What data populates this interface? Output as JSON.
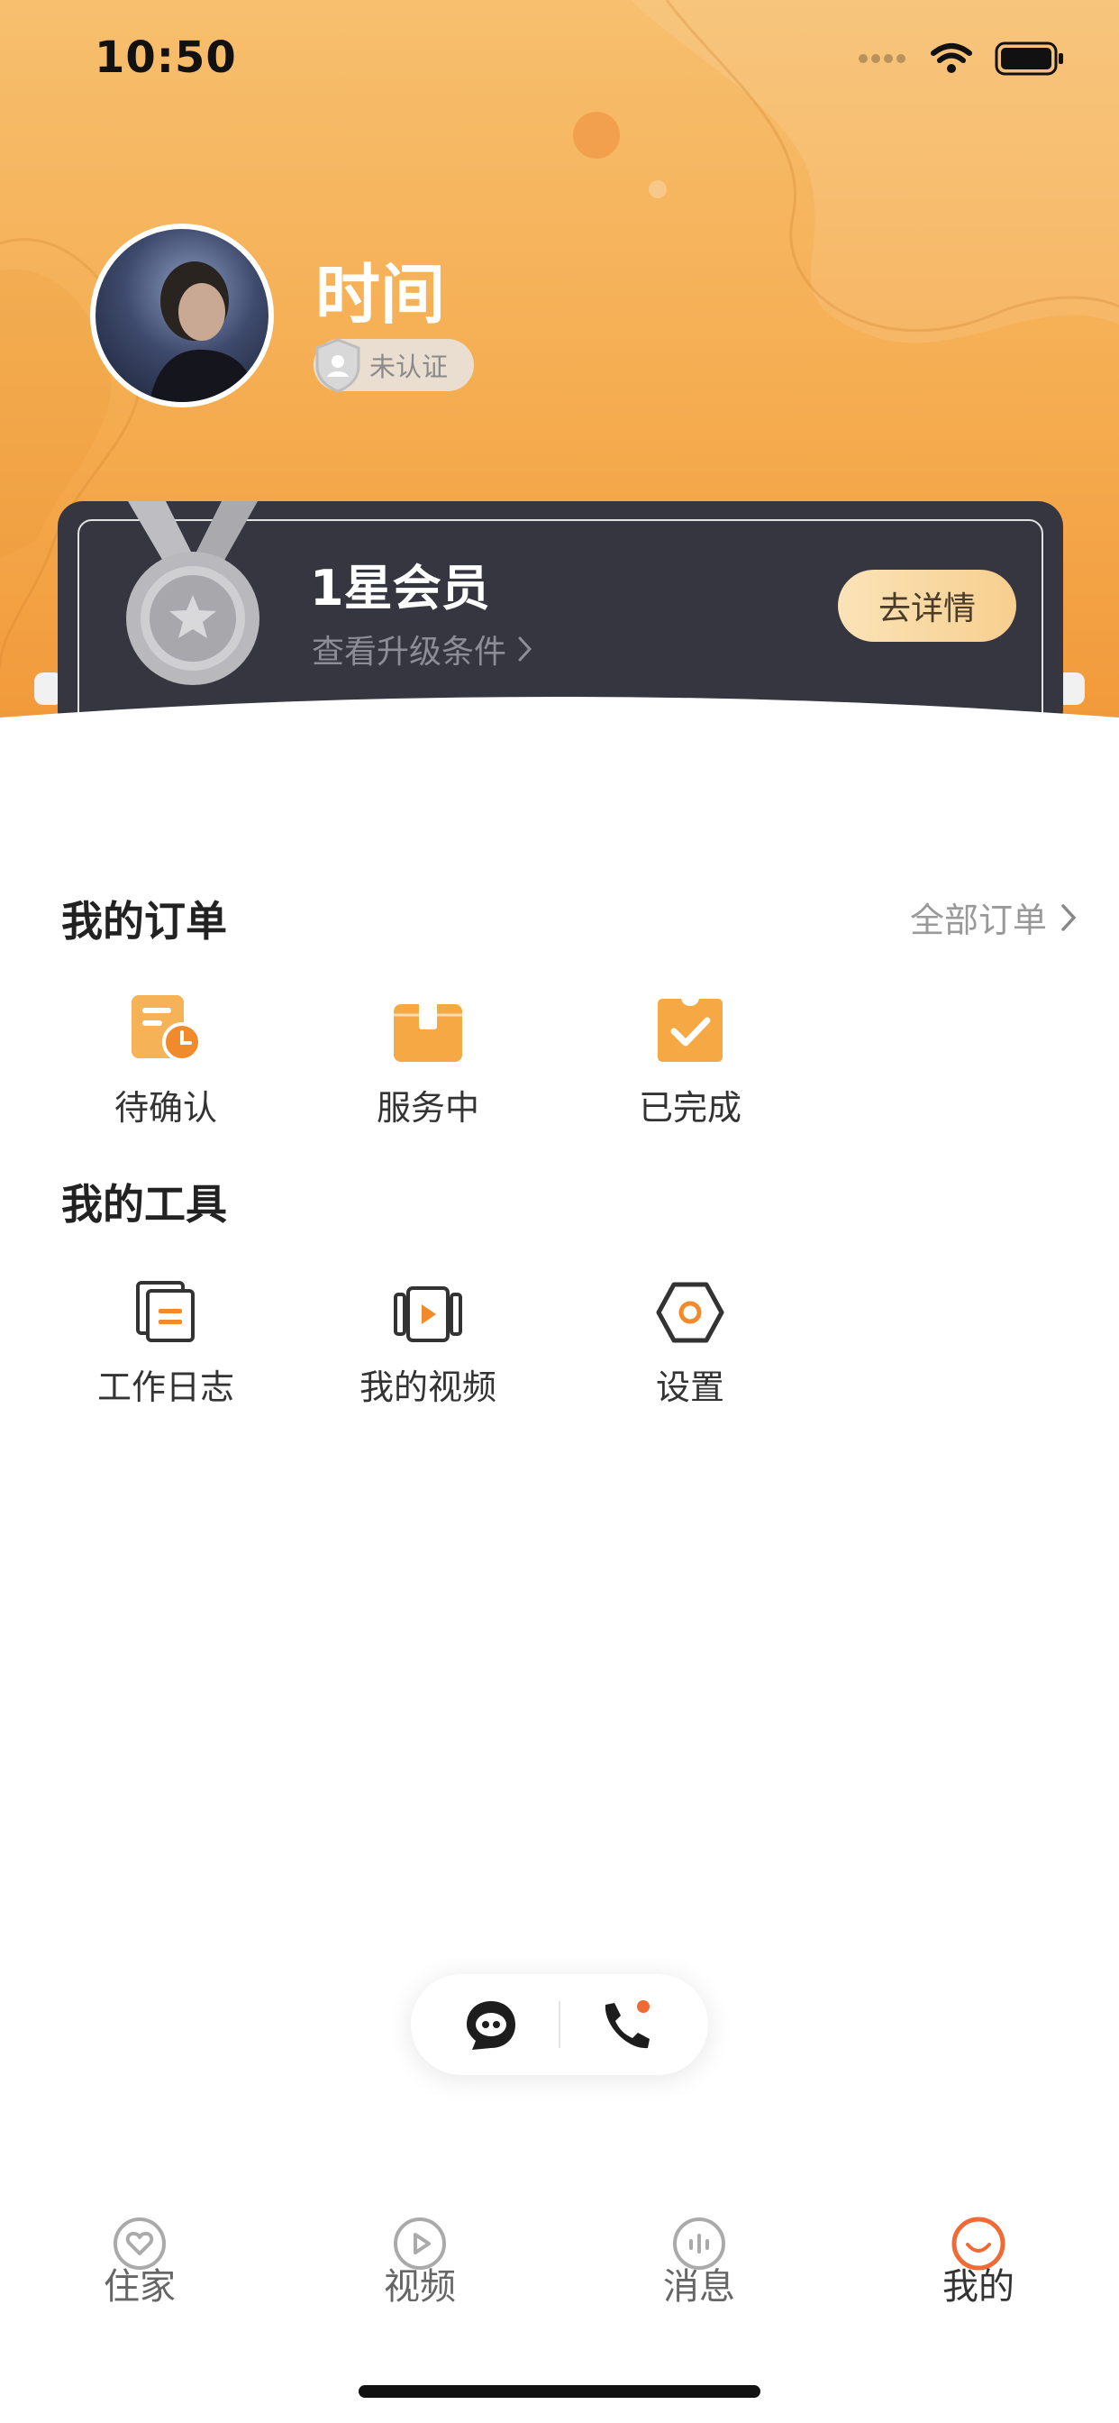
{
  "status_bar": {
    "time": "10:50"
  },
  "profile": {
    "username": "时间",
    "auth_status": "未认证"
  },
  "membership": {
    "level": "1星会员",
    "upgrade_link": "查看升级条件",
    "detail_button": "去详情"
  },
  "orders": {
    "title": "我的订单",
    "all_orders": "全部订单",
    "items": [
      {
        "label": "待确认",
        "icon": "pending-confirm-icon"
      },
      {
        "label": "服务中",
        "icon": "in-service-box-icon"
      },
      {
        "label": "已完成",
        "icon": "completed-check-icon"
      }
    ]
  },
  "tools": {
    "title": "我的工具",
    "items": [
      {
        "label": "工作日志",
        "icon": "work-log-icon"
      },
      {
        "label": "我的视频",
        "icon": "my-video-icon"
      },
      {
        "label": "设置",
        "icon": "settings-hex-icon"
      }
    ]
  },
  "float_actions": [
    {
      "icon": "chat-bubble-icon"
    },
    {
      "icon": "phone-call-icon"
    }
  ],
  "tabbar": {
    "items": [
      {
        "label": "住家",
        "icon": "heart-circle-icon"
      },
      {
        "label": "视频",
        "icon": "play-circle-icon"
      },
      {
        "label": "消息",
        "icon": "message-circle-icon"
      },
      {
        "label": "我的",
        "icon": "smile-circle-icon",
        "active": true
      }
    ]
  },
  "colors": {
    "header_orange": "#f5ab4e",
    "accent_orange": "#f08a2a",
    "card_dark": "#363640",
    "gold_button": "#f7cf8e",
    "active_tab": "#f06a35"
  }
}
